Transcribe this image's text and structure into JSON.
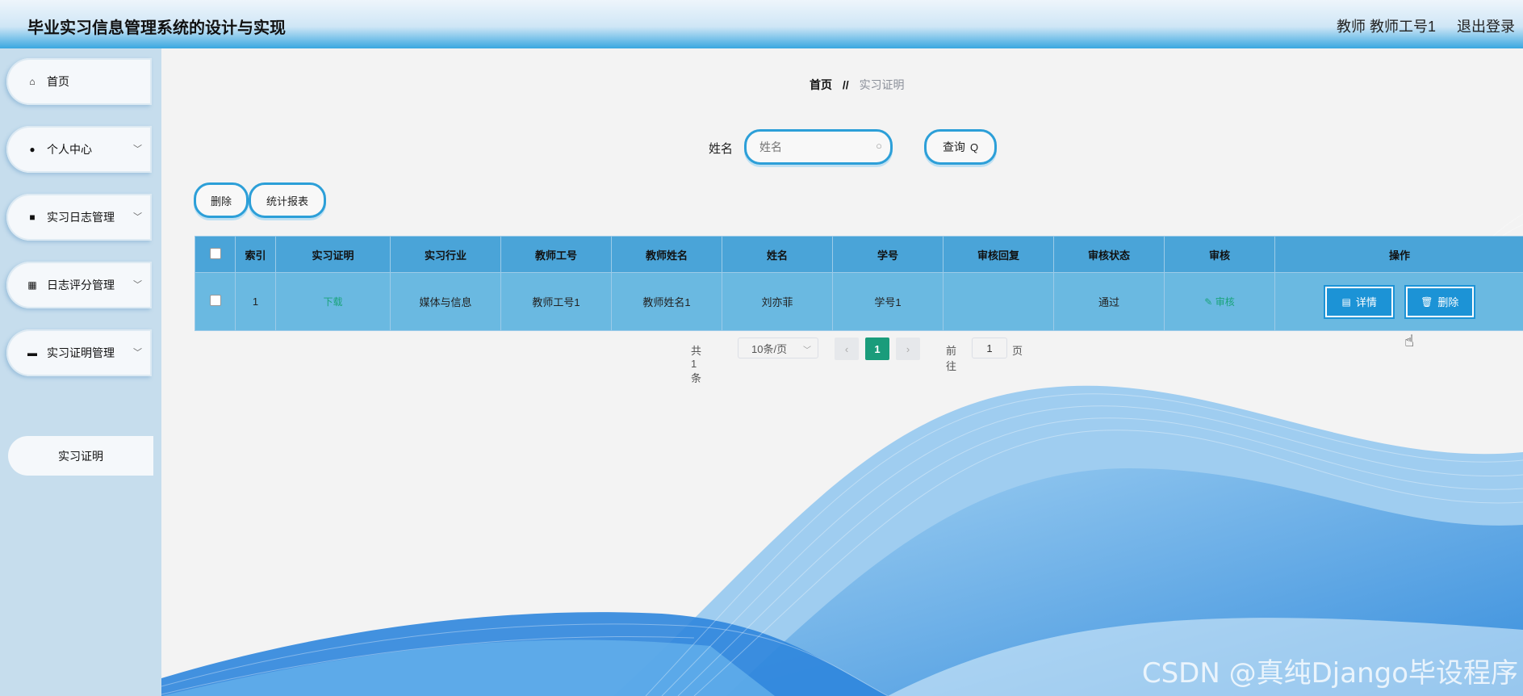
{
  "app": {
    "title": "毕业实习信息管理系统的设计与实现"
  },
  "header": {
    "user": "教师 教师工号1",
    "logout": "退出登录"
  },
  "sidebar": {
    "items": [
      {
        "label": "首页",
        "icon": "home-icon"
      },
      {
        "label": "个人中心",
        "icon": "user-icon"
      },
      {
        "label": "实习日志管理",
        "icon": "briefcase-icon"
      },
      {
        "label": "日志评分管理",
        "icon": "grid-icon"
      },
      {
        "label": "实习证明管理",
        "icon": "printer-icon"
      }
    ],
    "subitem": "实习证明"
  },
  "breadcrumb": {
    "home": "首页",
    "separator": "//",
    "current": "实习证明"
  },
  "search": {
    "label": "姓名",
    "placeholder": "姓名",
    "button": "查询"
  },
  "actions": {
    "delete": "删除",
    "report": "统计报表"
  },
  "table": {
    "headers": [
      "索引",
      "实习证明",
      "实习行业",
      "教师工号",
      "教师姓名",
      "姓名",
      "学号",
      "审核回复",
      "审核状态",
      "审核",
      "操作"
    ],
    "rows": [
      {
        "index": "1",
        "certificate": "下载",
        "industry": "媒体与信息",
        "teacher_id": "教师工号1",
        "teacher_name": "教师姓名1",
        "name": "刘亦菲",
        "student_id": "学号1",
        "reply": "",
        "status": "通过",
        "review": "审核",
        "detail_btn": "详情",
        "delete_btn": "删除"
      }
    ]
  },
  "pagination": {
    "total": "共 1 条",
    "page_size": "10条/页",
    "current": "1",
    "goto": "前往",
    "goto_value": "1",
    "page_unit": "页"
  },
  "watermark": "CSDN @真纯Django毕设程序",
  "colors": {
    "accent": "#2c9fd8",
    "header_row": "#4aa4d8",
    "body_row": "#6ab9e1",
    "page_active": "#1a9c7b"
  }
}
